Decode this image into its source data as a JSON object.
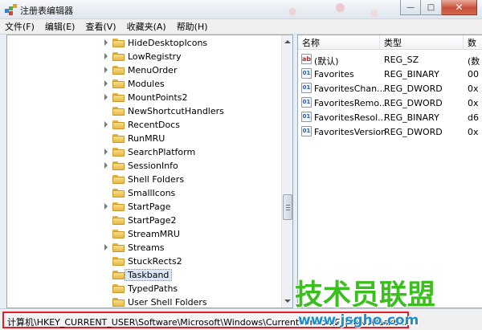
{
  "window": {
    "title": "注册表编辑器",
    "minimize_glyph": "—",
    "maximize_glyph": "□",
    "close_glyph": "✕"
  },
  "menu": [
    "文件(F)",
    "编辑(E)",
    "查看(V)",
    "收藏夹(A)",
    "帮助(H)"
  ],
  "tree": {
    "items": [
      {
        "label": "HideDesktopIcons",
        "expandable": true
      },
      {
        "label": "LowRegistry",
        "expandable": true
      },
      {
        "label": "MenuOrder",
        "expandable": true
      },
      {
        "label": "Modules",
        "expandable": true
      },
      {
        "label": "MountPoints2",
        "expandable": true
      },
      {
        "label": "NewShortcutHandlers",
        "expandable": false
      },
      {
        "label": "RecentDocs",
        "expandable": true
      },
      {
        "label": "RunMRU",
        "expandable": false
      },
      {
        "label": "SearchPlatform",
        "expandable": true
      },
      {
        "label": "SessionInfo",
        "expandable": true
      },
      {
        "label": "Shell Folders",
        "expandable": false
      },
      {
        "label": "SmallIcons",
        "expandable": false
      },
      {
        "label": "StartPage",
        "expandable": true
      },
      {
        "label": "StartPage2",
        "expandable": false
      },
      {
        "label": "StreamMRU",
        "expandable": false
      },
      {
        "label": "Streams",
        "expandable": true
      },
      {
        "label": "StuckRects2",
        "expandable": false
      },
      {
        "label": "Taskband",
        "expandable": false,
        "selected": true
      },
      {
        "label": "TypedPaths",
        "expandable": false
      },
      {
        "label": "User Shell Folders",
        "expandable": false
      }
    ]
  },
  "values": {
    "columns": [
      "名称",
      "类型",
      "数"
    ],
    "rows": [
      {
        "name": "(默认)",
        "type": "REG_SZ",
        "data": "(数",
        "icon": "ab"
      },
      {
        "name": "Favorites",
        "type": "REG_BINARY",
        "data": "00",
        "icon": "bin"
      },
      {
        "name": "FavoritesChan...",
        "type": "REG_DWORD",
        "data": "0x",
        "icon": "bin"
      },
      {
        "name": "FavoritesRemo...",
        "type": "REG_DWORD",
        "data": "0x",
        "icon": "bin"
      },
      {
        "name": "FavoritesResol...",
        "type": "REG_BINARY",
        "data": "d6",
        "icon": "bin"
      },
      {
        "name": "FavoritesVersion",
        "type": "REG_DWORD",
        "data": "0x",
        "icon": "bin"
      }
    ]
  },
  "statusbar": {
    "path": "计算机\\HKEY_CURRENT_USER\\Software\\Microsoft\\Windows\\CurrentVersion\\Explorer\\Taskband"
  },
  "watermark": {
    "title": "技术员联盟",
    "url": "www.jsgho.com"
  },
  "colors": {
    "highlight_border": "#e21d2b",
    "watermark_green": "#3bbf1e",
    "watermark_blue": "#1a8fd6"
  }
}
